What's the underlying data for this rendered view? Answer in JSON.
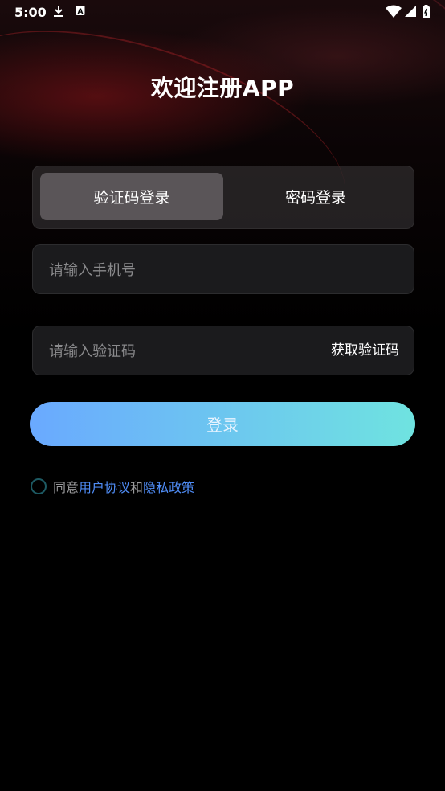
{
  "status_bar": {
    "time": "5:00",
    "icons": [
      "download-icon",
      "a-icon",
      "wifi-icon",
      "signal-icon",
      "battery-icon"
    ]
  },
  "page": {
    "title": "欢迎注册APP"
  },
  "tabs": {
    "active_label": "验证码登录",
    "inactive_label": "密码登录"
  },
  "form": {
    "phone_placeholder": "请输入手机号",
    "code_placeholder": "请输入验证码",
    "get_code_label": "获取验证码",
    "login_label": "登录"
  },
  "agreement": {
    "prefix": "同意",
    "user_agreement": "用户协议",
    "and": "和",
    "privacy_policy": "隐私政策"
  },
  "colors": {
    "background": "#000000",
    "accent_start": "#6aa9ff",
    "accent_end": "#6fe3e0",
    "link": "#4f8cf5"
  }
}
